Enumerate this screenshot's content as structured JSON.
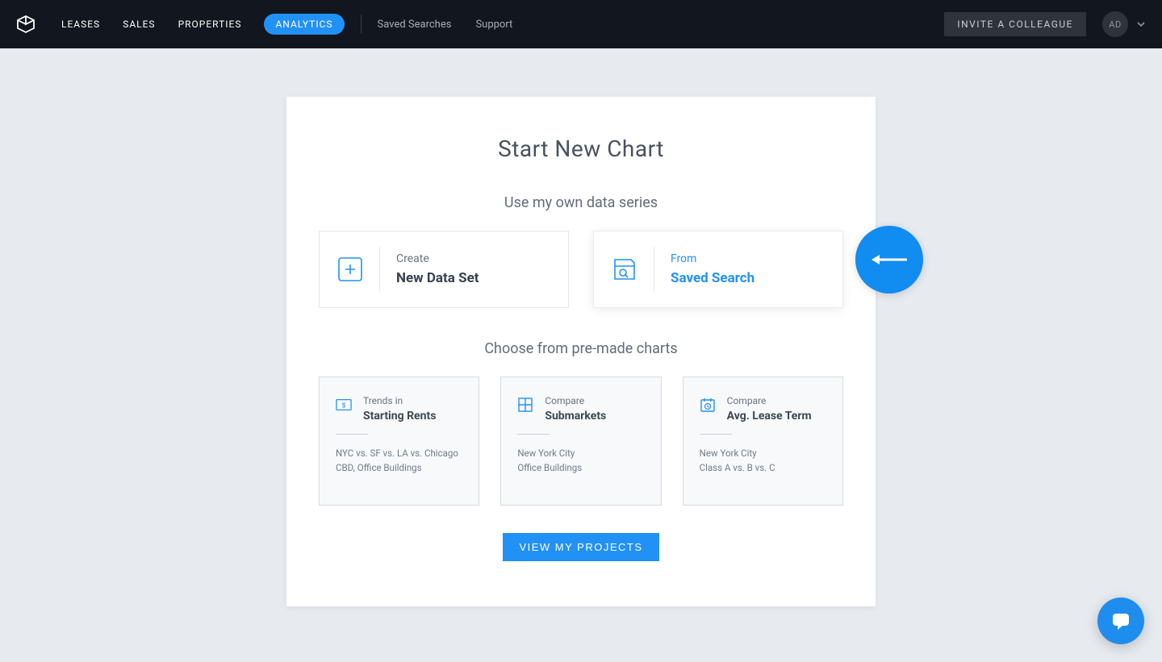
{
  "nav": {
    "primary": [
      "LEASES",
      "SALES",
      "PROPERTIES",
      "ANALYTICS"
    ],
    "active_index": 3,
    "secondary": [
      "Saved Searches",
      "Support"
    ],
    "invite_label": "INVITE A COLLEAGUE",
    "avatar_initials": "AD"
  },
  "card": {
    "title": "Start New Chart",
    "section_own_data": "Use my own data series",
    "option_create": {
      "top": "Create",
      "title": "New Data Set"
    },
    "option_saved": {
      "top": "From",
      "title": "Saved Search"
    },
    "section_premade": "Choose from pre-made charts",
    "premade": [
      {
        "top": "Trends in",
        "title": "Starting Rents",
        "desc1": "NYC vs. SF vs. LA vs. Chicago",
        "desc2": "CBD, Office Buildings"
      },
      {
        "top": "Compare",
        "title": "Submarkets",
        "desc1": "New York City",
        "desc2": "Office Buildings"
      },
      {
        "top": "Compare",
        "title": "Avg. Lease Term",
        "desc1": "New York City",
        "desc2": "Class A vs. B vs. C"
      }
    ],
    "view_projects_label": "VIEW MY PROJECTS"
  }
}
